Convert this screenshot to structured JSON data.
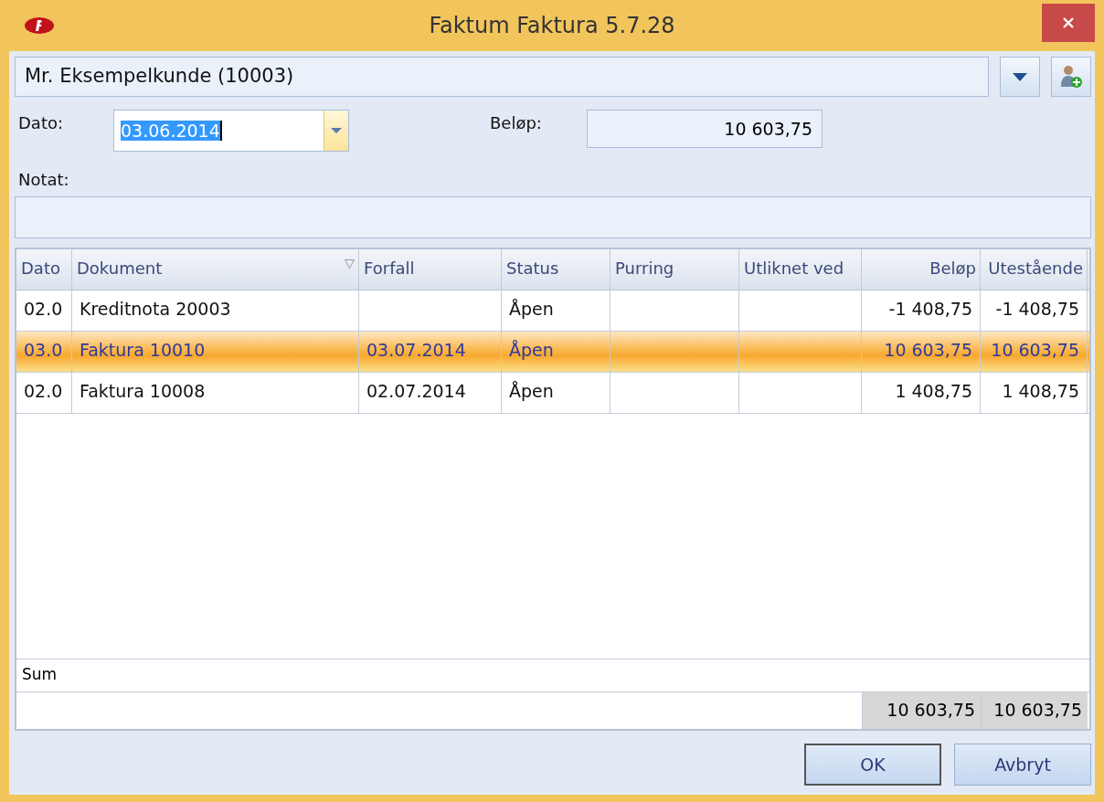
{
  "window": {
    "title": "Faktum Faktura 5.7.28"
  },
  "customer": {
    "value": "Mr. Eksempelkunde (10003)"
  },
  "date": {
    "label": "Dato:",
    "value": "03.06.2014"
  },
  "amount": {
    "label": "Beløp:",
    "value": "10 603,75"
  },
  "note": {
    "label": "Notat:"
  },
  "table": {
    "columns": [
      {
        "label": "Dato",
        "filter": false
      },
      {
        "label": "Dokument",
        "filter": true
      },
      {
        "label": "Forfall",
        "filter": false
      },
      {
        "label": "Status",
        "filter": false
      },
      {
        "label": "Purring",
        "filter": false
      },
      {
        "label": "Utliknet ved",
        "filter": false
      },
      {
        "label": "Beløp",
        "filter": false
      },
      {
        "label": "Utestående",
        "filter": false
      }
    ],
    "rows": [
      {
        "selected": false,
        "cells": [
          "02.0",
          "Kreditnota 20003",
          "",
          "Åpen",
          "",
          "",
          "-1 408,75",
          "-1 408,75"
        ]
      },
      {
        "selected": true,
        "cells": [
          "03.0",
          "Faktura 10010",
          "03.07.2014",
          "Åpen",
          "",
          "",
          "10 603,75",
          "10 603,75"
        ]
      },
      {
        "selected": false,
        "cells": [
          "02.0",
          "Faktura 10008",
          "02.07.2014",
          "Åpen",
          "",
          "",
          "1 408,75",
          "1 408,75"
        ]
      }
    ],
    "sum_label": "Sum",
    "totals": [
      "10 603,75",
      "10 603,75"
    ]
  },
  "buttons": [
    "OK",
    "Avbryt"
  ]
}
